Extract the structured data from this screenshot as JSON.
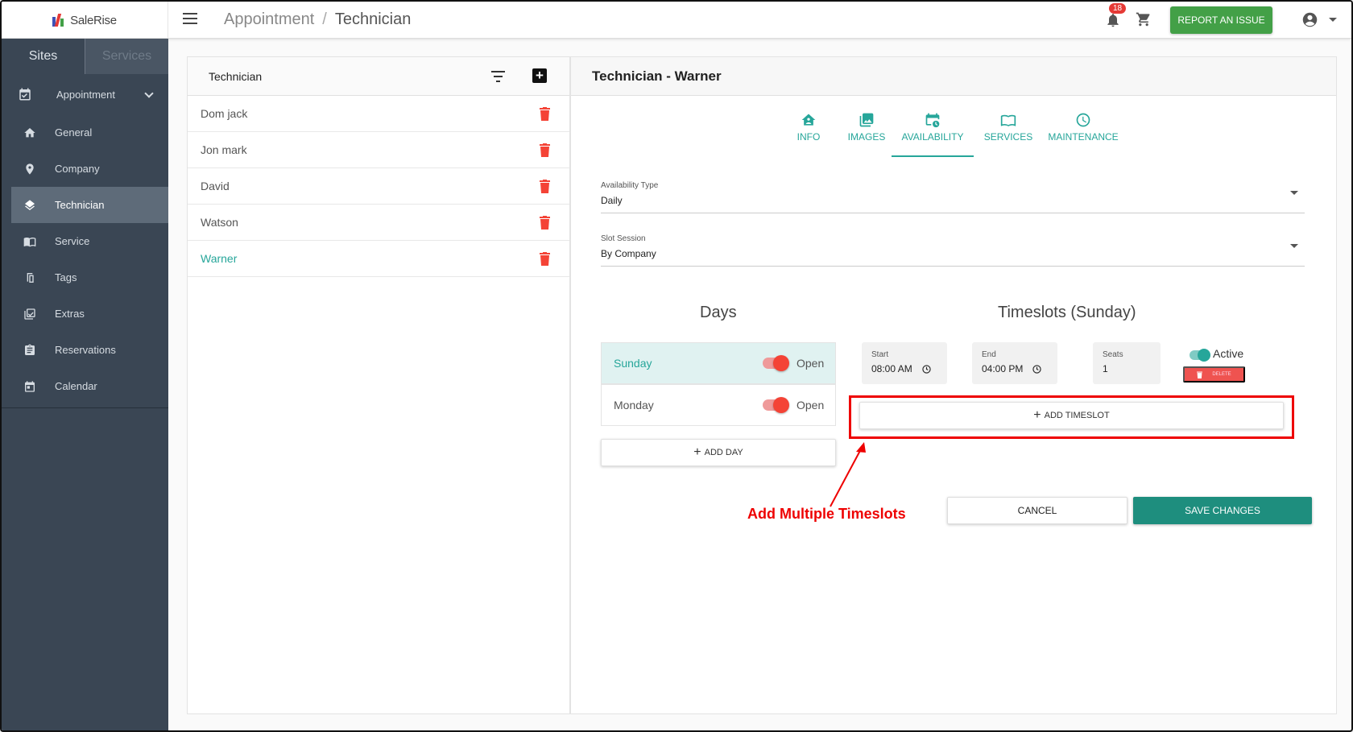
{
  "app": {
    "logo_text": "SaleRise"
  },
  "header": {
    "breadcrumb": [
      "Appointment",
      "Technician"
    ],
    "breadcrumb_separator": "/",
    "notification_count": "18",
    "report_label": "REPORT AN ISSUE"
  },
  "sidebar": {
    "tabs": [
      "Sites",
      "Services"
    ],
    "parent": {
      "label": "Appointment",
      "icon": "calendar-check-icon"
    },
    "items": [
      {
        "label": "General",
        "icon": "home-icon"
      },
      {
        "label": "Company",
        "icon": "location-pin-icon"
      },
      {
        "label": "Technician",
        "icon": "layers-icon",
        "active": true
      },
      {
        "label": "Service",
        "icon": "book-icon"
      },
      {
        "label": "Tags",
        "icon": "tag-icon"
      },
      {
        "label": "Extras",
        "icon": "checklist-icon"
      },
      {
        "label": "Reservations",
        "icon": "clipboard-icon"
      },
      {
        "label": "Calendar",
        "icon": "calendar-icon"
      }
    ]
  },
  "list": {
    "title": "Technician",
    "items": [
      "Dom jack",
      "Jon mark",
      "David",
      "Watson",
      "Warner"
    ],
    "selected": "Warner"
  },
  "detail": {
    "title": "Technician - Warner",
    "tabs": [
      "INFO",
      "IMAGES",
      "AVAILABILITY",
      "SERVICES",
      "MAINTENANCE"
    ],
    "active_tab": "AVAILABILITY",
    "availability_type": {
      "label": "Availability Type",
      "value": "Daily"
    },
    "slot_session": {
      "label": "Slot Session",
      "value": "By Company"
    },
    "days_title": "Days",
    "timeslots_title": "Timeslots (Sunday)",
    "days": [
      {
        "name": "Sunday",
        "state": "Open",
        "selected": true
      },
      {
        "name": "Monday",
        "state": "Open",
        "selected": false
      }
    ],
    "add_day_label": "ADD DAY",
    "timeslot": {
      "start_label": "Start",
      "start_value": "08:00 AM",
      "end_label": "End",
      "end_value": "04:00 PM",
      "seats_label": "Seats",
      "seats_value": "1",
      "active_label": "Active",
      "delete_label": "DELETE"
    },
    "add_timeslot_label": "ADD TIMESLOT",
    "annotation": "Add Multiple Timeslots",
    "cancel_label": "CANCEL",
    "save_label": "SAVE CHANGES"
  },
  "colors": {
    "accent": "#26a69a",
    "sidebar": "#3a4654",
    "report": "#43a047",
    "annotation": "#ee0000",
    "danger": "#f44336"
  }
}
